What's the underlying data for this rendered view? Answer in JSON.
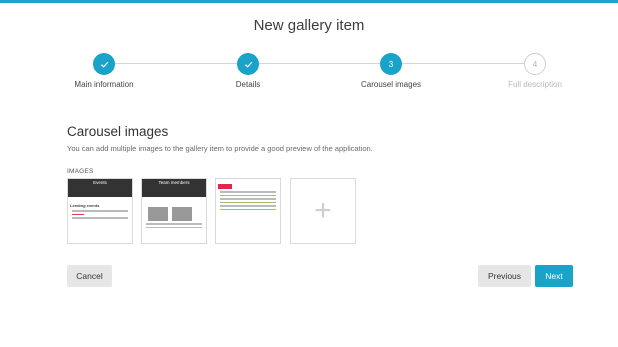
{
  "page": {
    "title": "New gallery item",
    "accent_color": "#1aa3c8"
  },
  "stepper": {
    "steps": [
      {
        "label": "Main information",
        "state": "done",
        "icon": "check-icon"
      },
      {
        "label": "Details",
        "state": "done",
        "icon": "check-icon"
      },
      {
        "label": "Carousel images",
        "state": "active",
        "number": "3"
      },
      {
        "label": "Full description",
        "state": "pending",
        "number": "4"
      }
    ]
  },
  "section": {
    "title": "Carousel images",
    "description": "You can add multiple images to the gallery item to provide a good preview of the application.",
    "images_label": "IMAGES"
  },
  "thumbnails": [
    {
      "caption": "Events",
      "sub": "Lending events"
    },
    {
      "caption": "Team members",
      "sub": ""
    },
    {
      "caption": "",
      "sub": ""
    }
  ],
  "add_icon": "plus-icon",
  "buttons": {
    "cancel": "Cancel",
    "previous": "Previous",
    "next": "Next"
  }
}
